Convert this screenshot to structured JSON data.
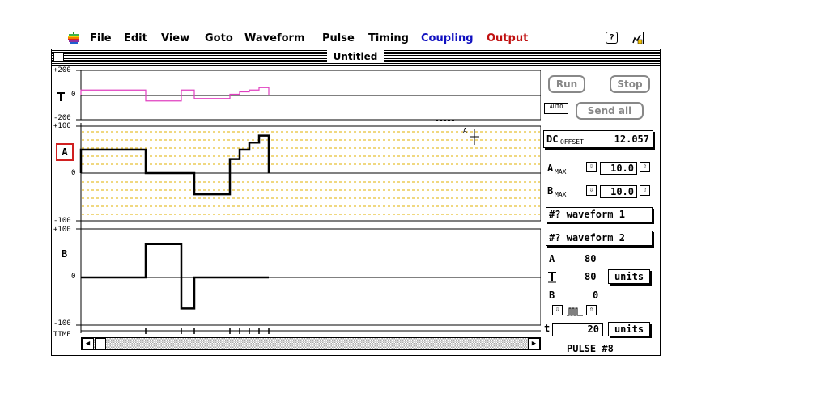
{
  "menubar": {
    "items": [
      "File",
      "Edit",
      "View",
      "Goto",
      "Waveform",
      "Pulse",
      "Timing",
      "Coupling",
      "Output"
    ],
    "colors": {
      "Coupling": "#1010c0",
      "Output": "#c01010"
    }
  },
  "window": {
    "title": "Untitled"
  },
  "panels": {
    "top": {
      "ymax_label": "+200",
      "zero_label": "0",
      "ymin_label": "-200"
    },
    "a": {
      "ymax_label": "+100",
      "zero_label": "0",
      "ymin_label": "-100",
      "channel": "A"
    },
    "b": {
      "ymax_label": "+100",
      "zero_label": "0",
      "ymin_label": "-100",
      "channel": "B"
    },
    "time_label": "TIME"
  },
  "waveforms": {
    "pulse_times": [
      0,
      20,
      31,
      35,
      46,
      49,
      52,
      55,
      58
    ],
    "top_levels": [
      45,
      -45,
      45,
      -25,
      10,
      30,
      45,
      65
    ],
    "a_levels": [
      50,
      0,
      0,
      -45,
      30,
      50,
      65,
      80
    ],
    "b_levels": [
      0,
      70,
      -65,
      0,
      0,
      0,
      0,
      0
    ],
    "top_color": "#e040c0"
  },
  "controls": {
    "run_label": "Run",
    "stop_label": "Stop",
    "auto_label": "AUTO",
    "send_all_label": "Send all",
    "dc_offset_label": "DC",
    "dc_offset_sub": "OFFSET",
    "dc_offset_value": "12.057",
    "amax_label": "A",
    "amax_sub": "MAX",
    "amax_value": "10.0",
    "bmax_label": "B",
    "bmax_sub": "MAX",
    "bmax_value": "10.0",
    "waveform1_label": "#? waveform 1",
    "waveform2_label": "#? waveform 2",
    "a_label": "A",
    "a_value": "80",
    "avg_value": "80",
    "units_label": "units",
    "b_label": "B",
    "b_value": "0",
    "t_label": "t",
    "t_value": "20",
    "pulse_label": "PULSE #8"
  },
  "cursor_label": "A"
}
